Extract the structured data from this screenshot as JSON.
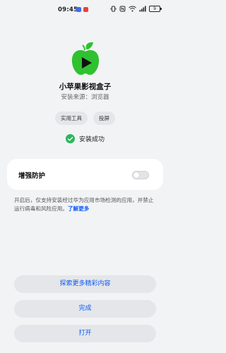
{
  "status_bar": {
    "time": "09:45",
    "battery": "9",
    "notification_colors": [
      "#3a6df0",
      "#e8413c"
    ]
  },
  "app": {
    "name": "小苹果影视盒子",
    "source": "安装来源：浏览器",
    "icon": "green-apple-play-icon",
    "icon_colors": {
      "apple": "#2fc12f",
      "leaf": "#2fc12f",
      "play": "#111111"
    }
  },
  "tags": [
    "实用工具",
    "投屏"
  ],
  "install_status": {
    "text": "安装成功",
    "icon": "check-circle-icon",
    "color": "#2db55d"
  },
  "protection": {
    "title": "增强防护",
    "enabled": false,
    "description": "开启后，仅支持安装经过华为应用市场检测的应用，并禁止运行病毒和风险应用。",
    "learn_more": "了解更多"
  },
  "buttons": {
    "explore": "探索更多精彩内容",
    "done": "完成",
    "open": "打开"
  },
  "accent_color": "#0a59f7"
}
